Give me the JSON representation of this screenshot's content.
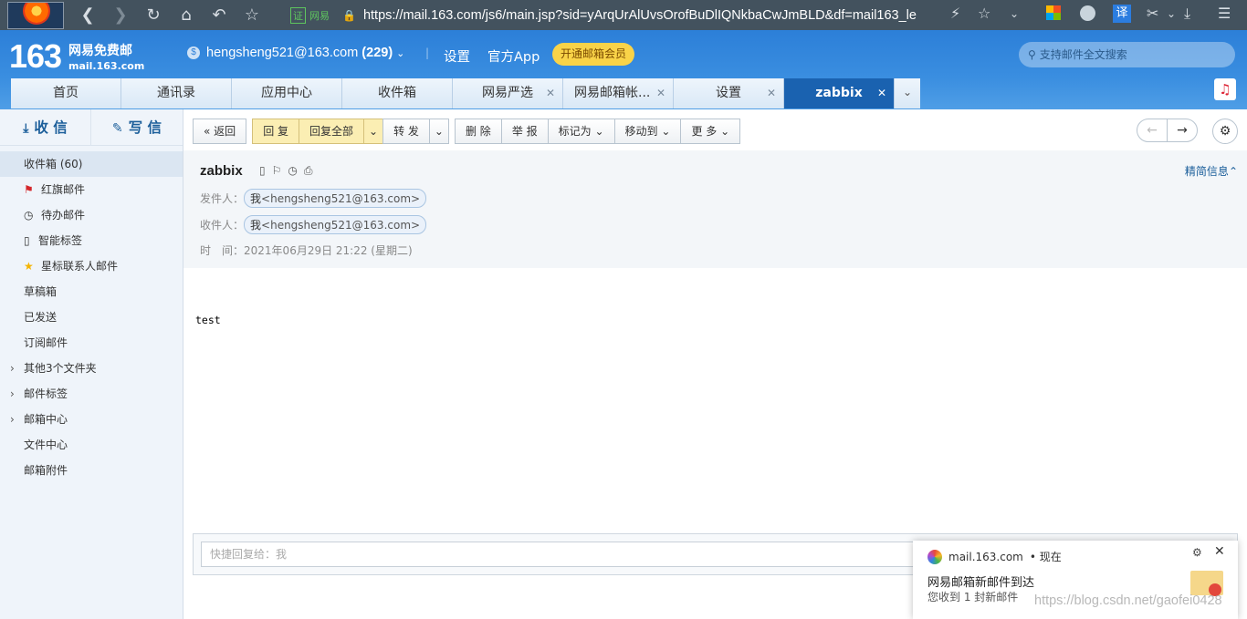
{
  "browser": {
    "tag_label": "网易",
    "url": "https://mail.163.com/js6/main.jsp?sid=yArqUrAlUvsOrofBuDlIQNkbaCwJmBLD&df=mail163_le"
  },
  "header": {
    "logo_number": "163",
    "logo_title": "网易免费邮",
    "logo_domain": "mail.163.com",
    "account_email": "hengsheng521@163.com",
    "account_count": "(229)",
    "settings_link": "设置",
    "app_link": "官方App",
    "vip_button": "开通邮箱会员",
    "search_placeholder": "支持邮件全文搜索"
  },
  "tabs": [
    {
      "label": "首页"
    },
    {
      "label": "通讯录"
    },
    {
      "label": "应用中心"
    },
    {
      "label": "收件箱"
    },
    {
      "label": "网易严选"
    },
    {
      "label": "网易邮箱帐..."
    },
    {
      "label": "设置"
    },
    {
      "label": "zabbix"
    }
  ],
  "sidebar": {
    "receive": "收 信",
    "write": "写 信",
    "folders": [
      {
        "label": "收件箱 (60)"
      },
      {
        "label": "红旗邮件"
      },
      {
        "label": "待办邮件"
      },
      {
        "label": "智能标签"
      },
      {
        "label": "星标联系人邮件"
      },
      {
        "label": "草稿箱"
      },
      {
        "label": "已发送"
      },
      {
        "label": "订阅邮件"
      },
      {
        "label": "其他3个文件夹"
      },
      {
        "label": "邮件标签"
      },
      {
        "label": "邮箱中心"
      },
      {
        "label": "文件中心"
      },
      {
        "label": "邮箱附件"
      }
    ]
  },
  "toolbar": {
    "back": "返回",
    "reply": "回 复",
    "reply_all": "回复全部",
    "forward": "转 发",
    "delete": "删 除",
    "report": "举 报",
    "mark_as": "标记为",
    "move_to": "移动到",
    "more": "更 多"
  },
  "mail": {
    "subject": "zabbix",
    "details_link": "精简信息",
    "from_label": "发件人：",
    "from_name": "我",
    "from_addr": "<hengsheng521@163.com>",
    "to_label": "收件人：",
    "to_name": "我",
    "to_addr": "<hengsheng521@163.com>",
    "time_label": "时　间：",
    "time_value": "2021年06月29日 21:22 (星期二)",
    "body": "test"
  },
  "quick_reply": {
    "placeholder": "快捷回复给：我"
  },
  "notification": {
    "source": "mail.163.com",
    "when": "• 现在",
    "title": "网易邮箱新邮件到达",
    "message": "您收到 1 封新邮件"
  },
  "watermark": "https://blog.csdn.net/gaofei0428"
}
